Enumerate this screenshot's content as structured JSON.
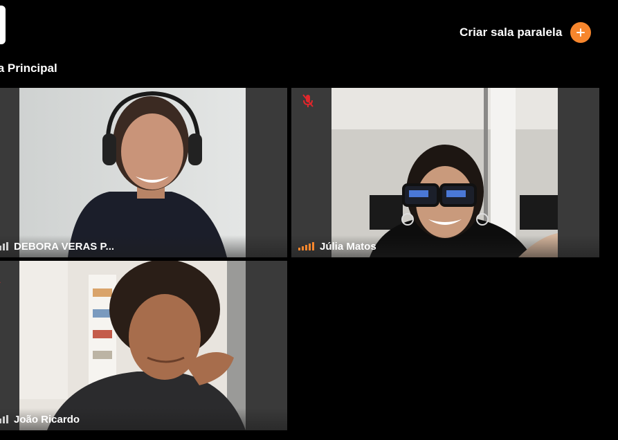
{
  "header": {
    "create_breakout_label": "Criar sala paralela"
  },
  "room": {
    "title": "la Principal"
  },
  "participants": [
    {
      "name": "DEBORA VERAS P...",
      "muted": false
    },
    {
      "name": "Júlia Matos",
      "muted": true
    },
    {
      "name": "João Ricardo",
      "muted": false
    }
  ],
  "colors": {
    "background": "#000000",
    "tile": "#3a3a3a",
    "accent": "#f7862d",
    "muted": "#e0262b"
  }
}
